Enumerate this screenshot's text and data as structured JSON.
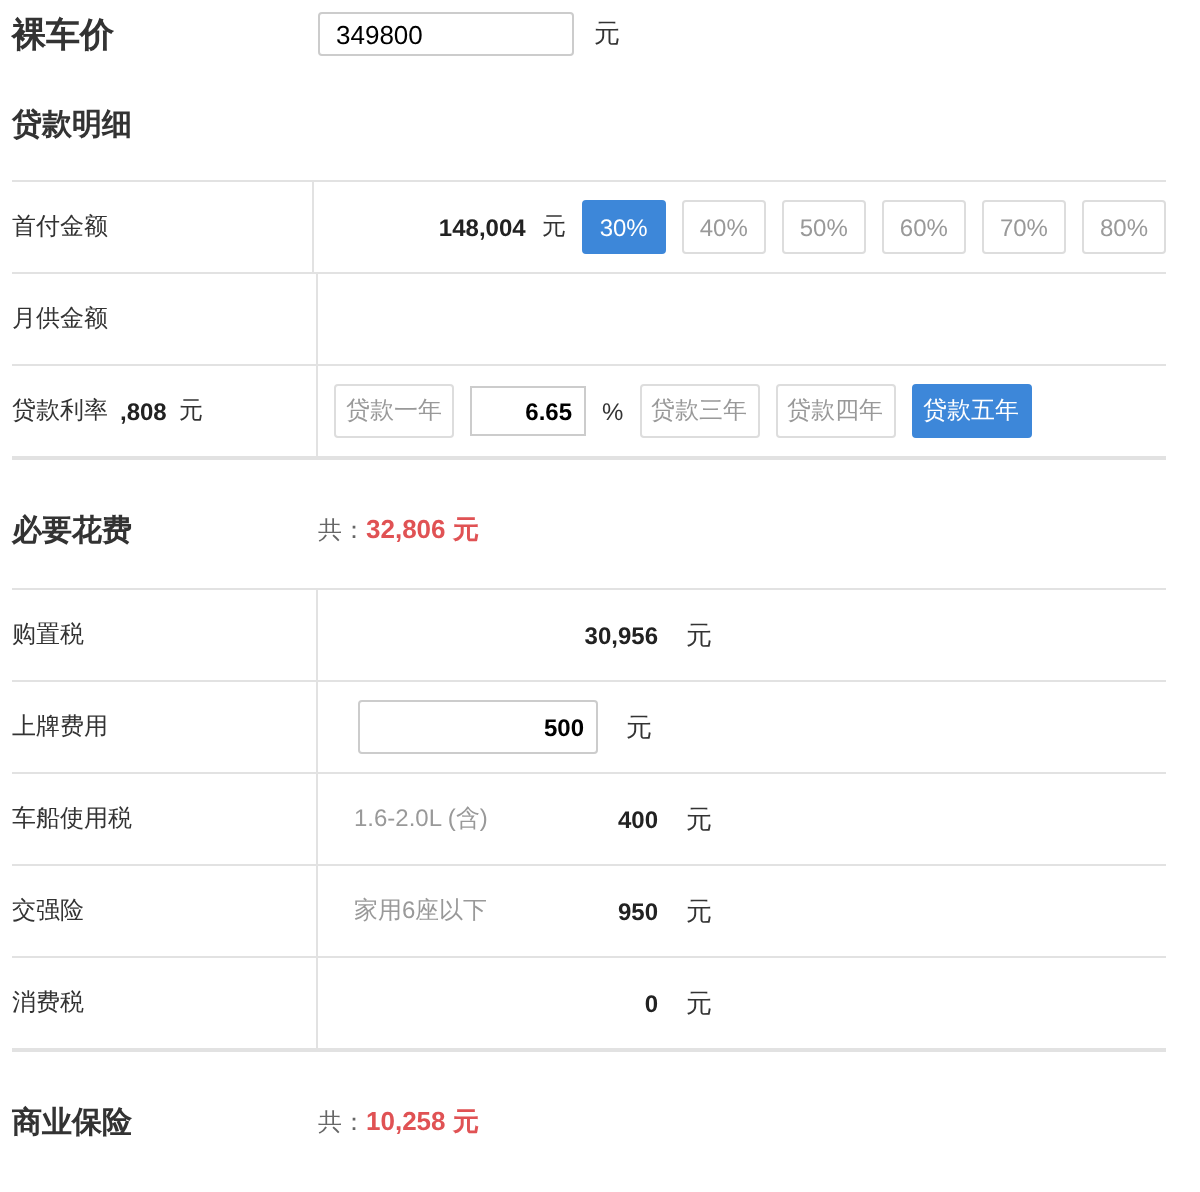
{
  "price": {
    "label": "裸车价",
    "value": "349800",
    "unit": "元"
  },
  "loan": {
    "title": "贷款明细",
    "rows": [
      {
        "kind": "down_payment",
        "label": "首付金额",
        "amount": "148,004",
        "unit": "元",
        "options": [
          {
            "label": "30%",
            "selected": true
          },
          {
            "label": "40%",
            "selected": false
          },
          {
            "label": "50%",
            "selected": false
          },
          {
            "label": "60%",
            "selected": false
          },
          {
            "label": "70%",
            "selected": false
          },
          {
            "label": "80%",
            "selected": false
          }
        ]
      },
      {
        "kind": "monthly",
        "label": "月供金额"
      },
      {
        "kind": "rate",
        "label": "贷款利率",
        "amount": ",808",
        "unit": "元",
        "terms": [
          {
            "kind": "term",
            "label": "贷款一年",
            "selected": false
          },
          {
            "kind": "rate_field",
            "value": "6.65",
            "unit": "%"
          },
          {
            "kind": "term",
            "label": "贷款三年",
            "selected": false
          },
          {
            "kind": "term",
            "label": "贷款四年",
            "selected": false
          },
          {
            "kind": "term",
            "label": "贷款五年",
            "selected": true
          }
        ]
      }
    ]
  },
  "fees": {
    "title": "必要花费",
    "total_prefix": "共：",
    "total": "32,806 元",
    "rows": [
      {
        "kind": "text",
        "label": "购置税",
        "amount": "30,956",
        "unit": "元"
      },
      {
        "kind": "input",
        "label": "上牌费用",
        "amount": "500",
        "unit": "元"
      },
      {
        "kind": "text",
        "label": "车船使用税",
        "note": "1.6-2.0L (含)",
        "amount": "400",
        "unit": "元"
      },
      {
        "kind": "text",
        "label": "交强险",
        "note": "家用6座以下",
        "amount": "950",
        "unit": "元"
      },
      {
        "kind": "text",
        "label": "消费税",
        "amount": "0",
        "unit": "元"
      }
    ]
  },
  "insurance": {
    "title": "商业保险",
    "total_prefix": "共：",
    "total": "10,258 元"
  }
}
